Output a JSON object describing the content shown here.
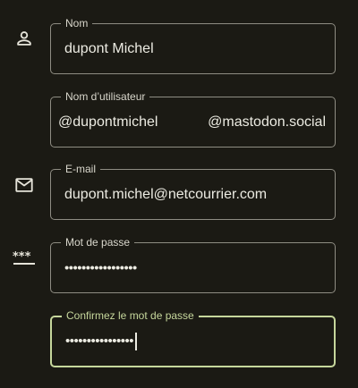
{
  "form": {
    "name": {
      "label": "Nom",
      "value": "dupont Michel",
      "icon": "person-icon"
    },
    "username": {
      "label": "Nom d’utilisateur",
      "prefix": "@",
      "value": "dupontmichel",
      "domain": "@mastodon.social"
    },
    "email": {
      "label": "E-mail",
      "value": "dupont.michel@netcourrier.com",
      "icon": "mail-icon"
    },
    "password": {
      "label": "Mot de passe",
      "value": "•••••••••••••••••",
      "icon": "password-icon"
    },
    "confirm_password": {
      "label": "Confirmez le mot de passe",
      "value": "••••••••••••••••"
    }
  },
  "colors": {
    "background": "#1b1a14",
    "border": "#8f8d83",
    "focus": "#c6d79c",
    "text": "#ecebe2"
  }
}
